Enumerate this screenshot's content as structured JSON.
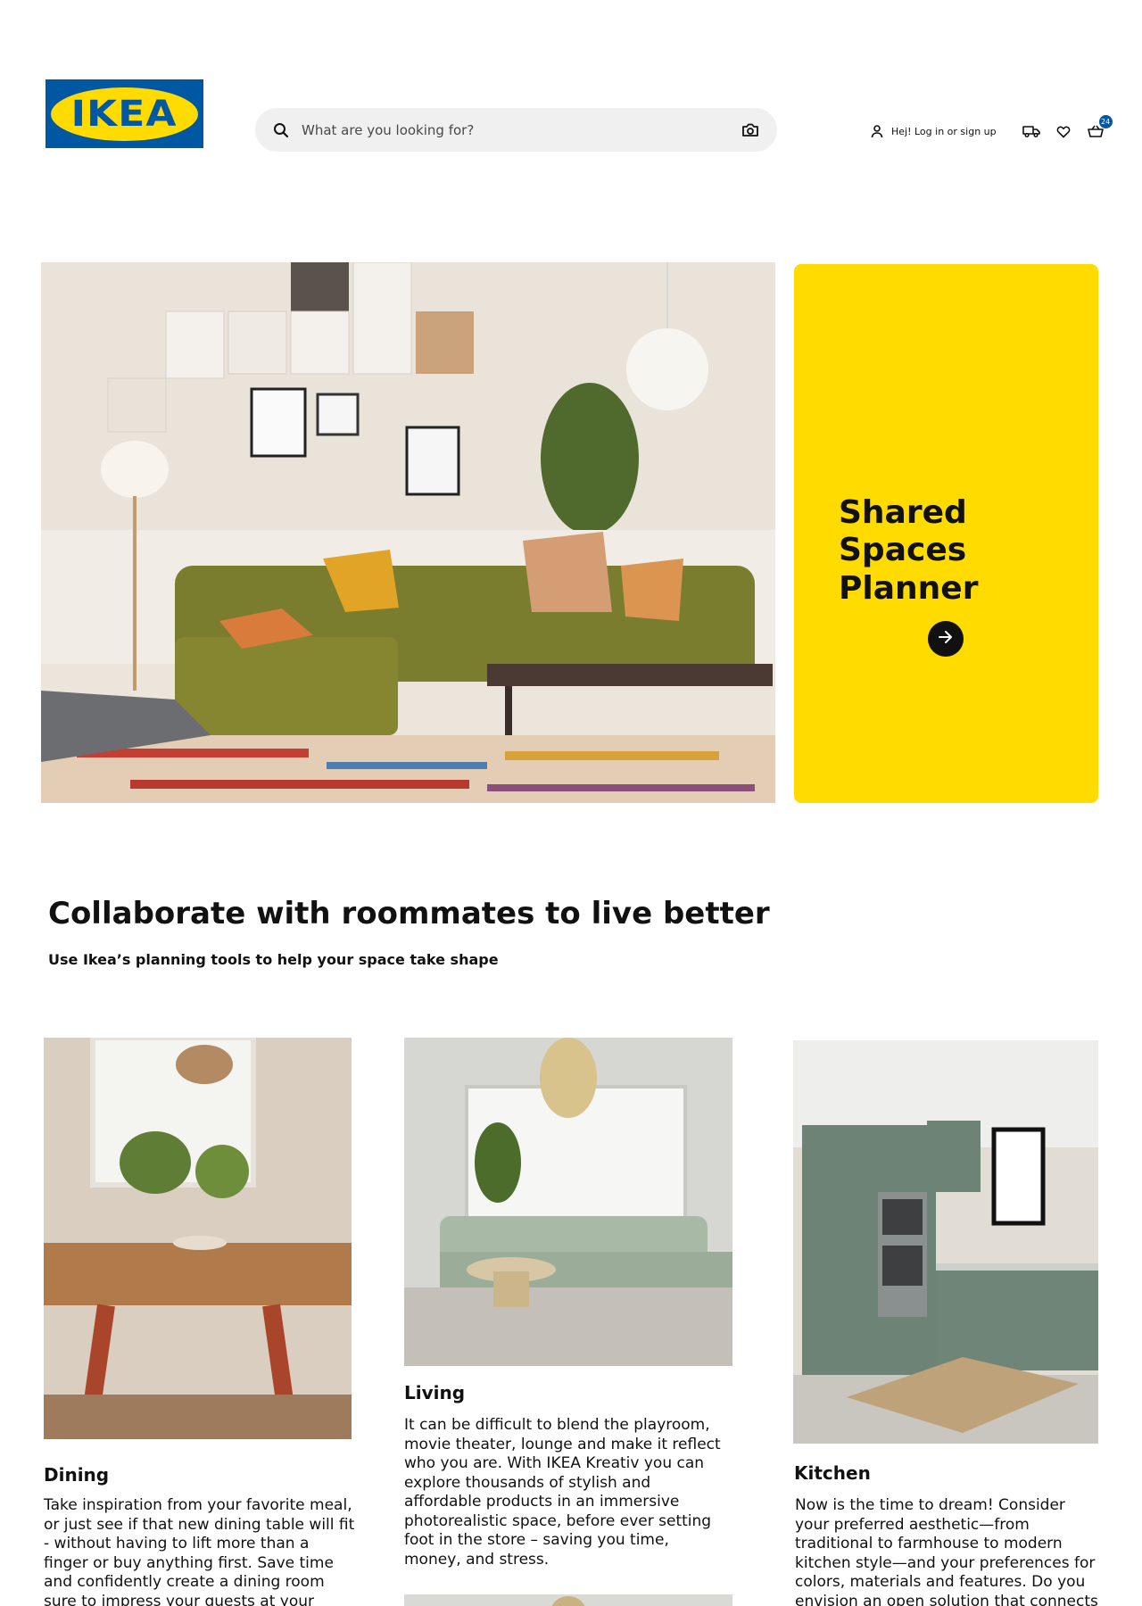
{
  "header": {
    "logo_text": "IKEA",
    "search_placeholder": "What are you looking for?",
    "login_label": "Hej! Log in or sign up",
    "cart_count": "24"
  },
  "hero": {
    "promo_title": "Shared Spaces Planner"
  },
  "section": {
    "title": "Collaborate with roommates to live better",
    "subtitle": "Use Ikea’s planning tools to help your space take shape"
  },
  "cards": [
    {
      "title": "Dining",
      "text": "Take inspiration from your favorite meal, or just see if that new dining table will fit - without having to lift more than a finger or buy anything first. Save time and confidently create a dining room sure to impress your guests at your"
    },
    {
      "title": "Living",
      "text": "It can be difficult to blend the playroom, movie theater, lounge and make it reflect who you are. With IKEA Kreativ you can explore thousands of stylish and affordable products in an immersive photorealistic space, before ever setting foot in the store – saving you time, money, and stress."
    },
    {
      "title": "Kitchen",
      "text": "Now is the time to dream! Consider your preferred aesthetic—from traditional to farmhouse to modern kitchen style—and your preferences for colors, materials and features. Do you envision an open solution that connects"
    }
  ],
  "colors": {
    "ikea_blue": "#0058a3",
    "ikea_yellow": "#ffdb00"
  }
}
